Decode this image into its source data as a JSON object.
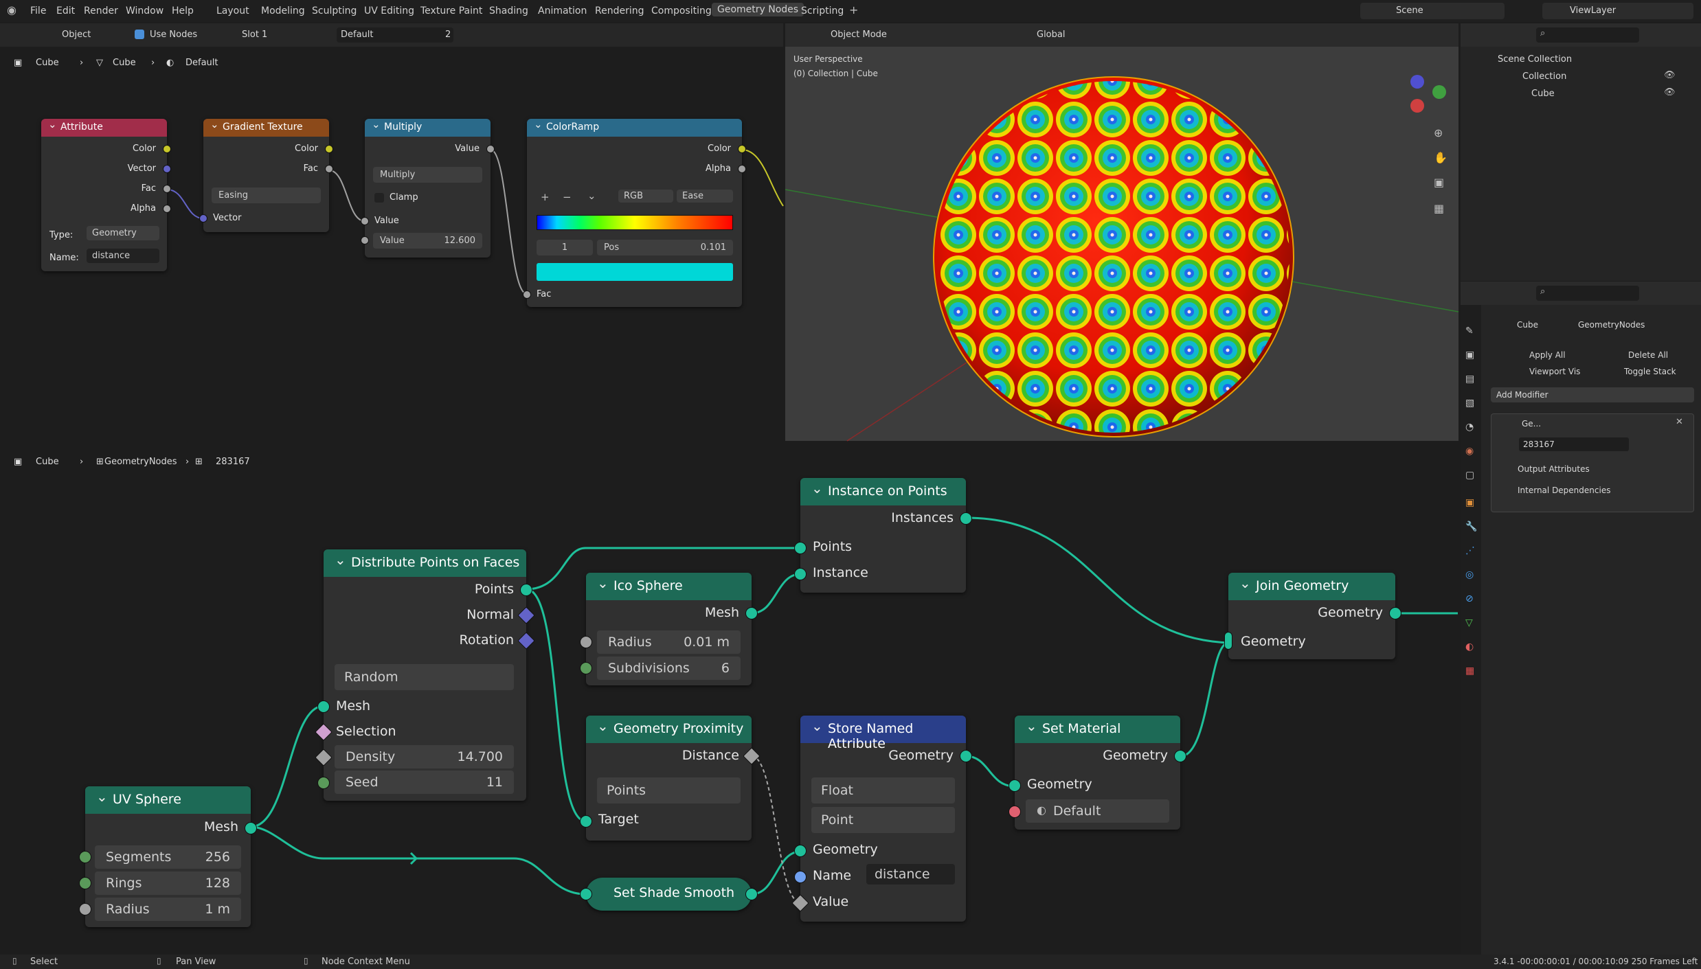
{
  "menu": [
    "File",
    "Edit",
    "Render",
    "Window",
    "Help"
  ],
  "workspaces": [
    "Layout",
    "Modeling",
    "Sculpting",
    "UV Editing",
    "Texture Paint",
    "Shading",
    "Animation",
    "Rendering",
    "Compositing",
    "Geometry Nodes",
    "Scripting"
  ],
  "active_workspace": "Geometry Nodes",
  "scene": "Scene",
  "view_layer": "ViewLayer",
  "shader_header": {
    "mode": "Object",
    "use_nodes": "Use Nodes",
    "slot": "Slot 1",
    "material": "Default",
    "users": "2"
  },
  "shader_breadcrumb": [
    "Cube",
    "Cube",
    "Default"
  ],
  "viewport_header": {
    "mode": "Object Mode",
    "orientation": "Global"
  },
  "viewport_overlay": {
    "line1": "User Perspective",
    "line2": "(0) Collection | Cube"
  },
  "outliner": {
    "scene_collection": "Scene Collection",
    "collection": "Collection",
    "object": "Cube"
  },
  "props": {
    "breadcrumb": [
      "Cube",
      "GeometryNodes"
    ],
    "apply_all": "Apply All",
    "delete_all": "Delete All",
    "viewport_vis": "Viewport Vis",
    "toggle_stack": "Toggle Stack",
    "add_modifier": "Add Modifier",
    "modifier_name": "Ge...",
    "node_group": "283167",
    "output_attributes": "Output Attributes",
    "internal_dependencies": "Internal Dependencies"
  },
  "geo_breadcrumb": [
    "Cube",
    "GeometryNodes",
    "283167"
  ],
  "shader_nodes": {
    "attribute": {
      "title": "Attribute",
      "color": "#a12d4a",
      "outs": [
        "Color",
        "Vector",
        "Fac",
        "Alpha"
      ],
      "type_label": "Type:",
      "type_value": "Geometry",
      "name_label": "Name:",
      "name_value": "distance"
    },
    "gradient": {
      "title": "Gradient Texture",
      "color": "#8c4a1a",
      "outs": [
        "Color",
        "Fac"
      ],
      "easing": "Easing",
      "in": "Vector"
    },
    "multiply": {
      "title": "Multiply",
      "color": "#2a6a8a",
      "out": "Value",
      "op": "Multiply",
      "clamp": "Clamp",
      "in": "Value",
      "value_label": "Value",
      "value": "12.600"
    },
    "colorramp": {
      "title": "ColorRamp",
      "color": "#2a6a8a",
      "outs": [
        "Color",
        "Alpha"
      ],
      "mode": "RGB",
      "interp": "Ease",
      "index": "1",
      "pos_label": "Pos",
      "pos": "0.101",
      "in": "Fac"
    }
  },
  "geo_nodes": {
    "uv_sphere": {
      "title": "UV Sphere",
      "out": "Mesh",
      "segments_label": "Segments",
      "segments": "256",
      "rings_label": "Rings",
      "rings": "128",
      "radius_label": "Radius",
      "radius": "1 m"
    },
    "distribute": {
      "title": "Distribute Points on Faces",
      "outs": [
        "Points",
        "Normal",
        "Rotation"
      ],
      "mode": "Random",
      "ins": [
        "Mesh",
        "Selection"
      ],
      "density_label": "Density",
      "density": "14.700",
      "seed_label": "Seed",
      "seed": "11"
    },
    "ico": {
      "title": "Ico Sphere",
      "out": "Mesh",
      "radius_label": "Radius",
      "radius": "0.01 m",
      "subdiv_label": "Subdivisions",
      "subdiv": "6"
    },
    "instance": {
      "title": "Instance on Points",
      "out": "Instances",
      "ins": [
        "Points",
        "Instance"
      ]
    },
    "proximity": {
      "title": "Geometry Proximity",
      "out": "Distance",
      "mode": "Points",
      "in": "Target"
    },
    "smooth": {
      "title": "Set Shade Smooth"
    },
    "store": {
      "title": "Store Named Attribute",
      "out": "Geometry",
      "type": "Float",
      "domain": "Point",
      "ins": [
        "Geometry",
        "Name",
        "Value"
      ],
      "name_value": "distance"
    },
    "material": {
      "title": "Set Material",
      "out": "Geometry",
      "in": "Geometry",
      "material": "Default"
    },
    "join": {
      "title": "Join Geometry",
      "out": "Geometry",
      "in": "Geometry"
    }
  },
  "status": {
    "select": "Select",
    "pan": "Pan View",
    "context": "Node Context Menu",
    "info": "3.4.1 -00:00:00:01 / 00:00:10:09  250 Frames Left"
  }
}
